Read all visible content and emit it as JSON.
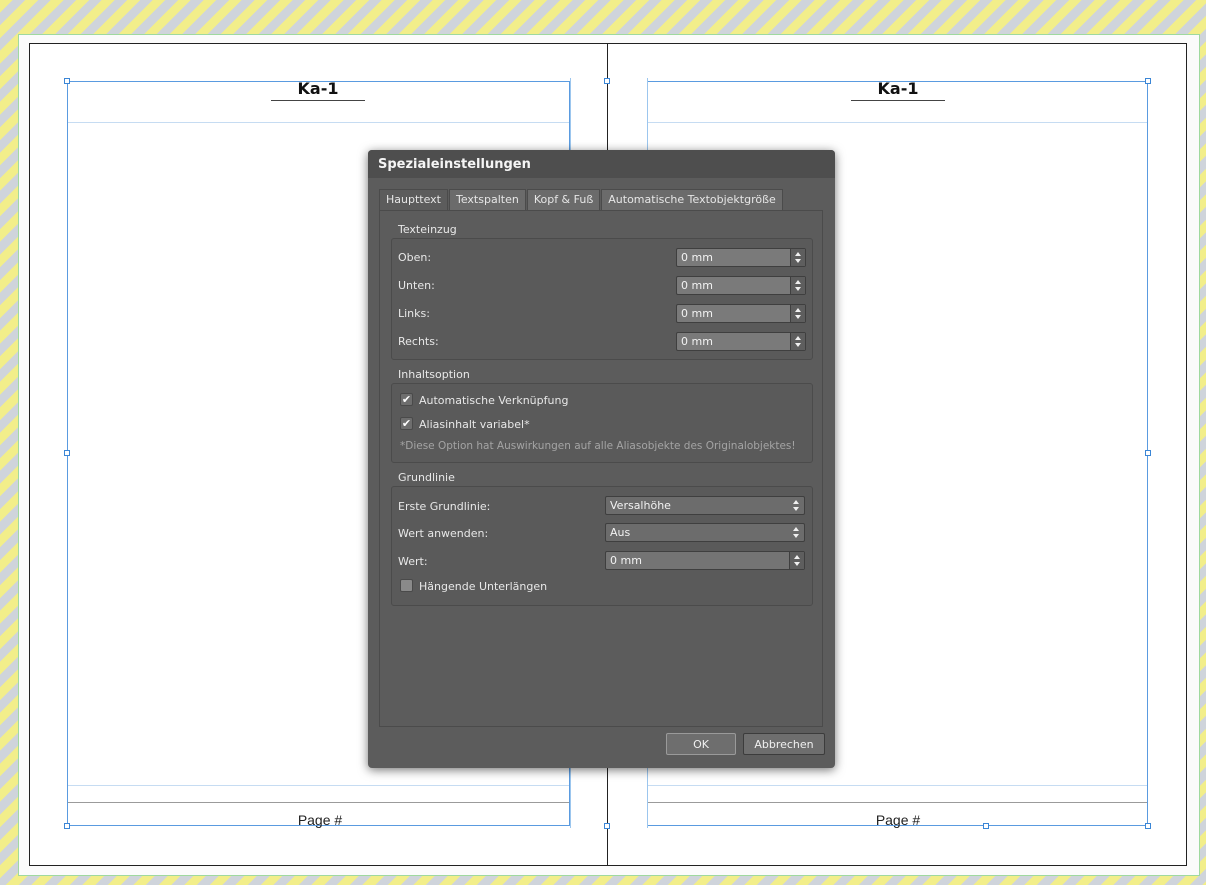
{
  "document": {
    "left_page": {
      "header": "Ka-1",
      "footer": "Page #"
    },
    "right_page": {
      "header": "Ka-1",
      "footer": "Page #"
    }
  },
  "dialog": {
    "title": "Spezialeinstellungen",
    "tabs": [
      {
        "label": "Haupttext",
        "active": true
      },
      {
        "label": "Textspalten",
        "active": false
      },
      {
        "label": "Kopf & Fuß",
        "active": false
      },
      {
        "label": "Automatische Textobjektgröße",
        "active": false
      }
    ],
    "texteinzug": {
      "label": "Texteinzug",
      "rows": [
        {
          "label": "Oben:",
          "value": "0 mm"
        },
        {
          "label": "Unten:",
          "value": "0 mm"
        },
        {
          "label": "Links:",
          "value": "0 mm"
        },
        {
          "label": "Rechts:",
          "value": "0 mm"
        }
      ]
    },
    "inhaltsoption": {
      "label": "Inhaltsoption",
      "auto_link": {
        "label": "Automatische Verknüpfung",
        "checked": true
      },
      "alias_variable": {
        "label": "Aliasinhalt variabel*",
        "checked": true
      },
      "hint": "*Diese Option hat Auswirkungen auf alle Aliasobjekte des Originalobjektes!"
    },
    "grundlinie": {
      "label": "Grundlinie",
      "erste": {
        "label": "Erste Grundlinie:",
        "value": "Versalhöhe"
      },
      "anwenden": {
        "label": "Wert anwenden:",
        "value": "Aus"
      },
      "wert": {
        "label": "Wert:",
        "value": "0 mm"
      },
      "haengend": {
        "label": "Hängende Unterlängen",
        "checked": false
      }
    },
    "buttons": {
      "ok": "OK",
      "cancel": "Abbrechen"
    }
  },
  "icons": {
    "check": "✔"
  }
}
